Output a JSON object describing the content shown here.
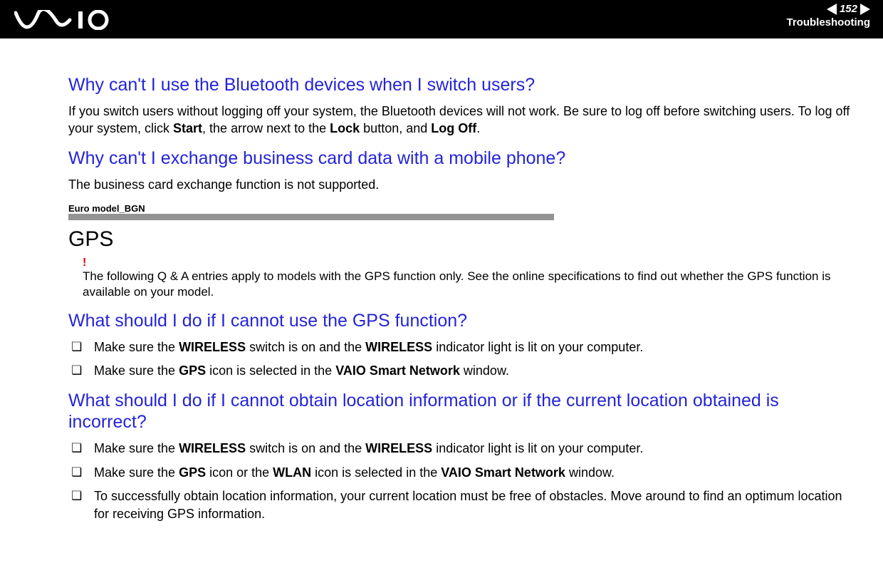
{
  "header": {
    "page_number": "152",
    "section": "Troubleshooting"
  },
  "q1": {
    "title": "Why can't I use the Bluetooth devices when I switch users?",
    "p_pre": "If you switch users without logging off your system, the Bluetooth devices will not work. Be sure to log off before switching users. To log off your system, click ",
    "b1": "Start",
    "mid1": ", the arrow next to the ",
    "b2": "Lock",
    "mid2": " button, and ",
    "b3": "Log Off",
    "post": "."
  },
  "q2": {
    "title": "Why can't I exchange business card data with a mobile phone?",
    "p": "The business card exchange function is not supported."
  },
  "section_tag": "Euro model_BGN",
  "gps": {
    "title": "GPS",
    "bang": "!",
    "note": "The following Q & A entries apply to models with the GPS function only. See the online specifications to find out whether the GPS function is available on your model."
  },
  "q3": {
    "title": "What should I do if I cannot use the GPS function?",
    "items": [
      {
        "pre": "Make sure the ",
        "b1": "WIRELESS",
        "mid1": " switch is on and the ",
        "b2": "WIRELESS",
        "mid2": " indicator light is lit on your computer."
      },
      {
        "pre": "Make sure the ",
        "b1": "GPS",
        "mid1": " icon is selected in the ",
        "b2": "VAIO Smart Network",
        "mid2": " window."
      }
    ]
  },
  "q4": {
    "title": "What should I do if I cannot obtain location information or if the current location obtained is incorrect?",
    "items": [
      {
        "pre": "Make sure the ",
        "b1": "WIRELESS",
        "mid1": " switch is on and the ",
        "b2": "WIRELESS",
        "mid2": " indicator light is lit on your computer."
      },
      {
        "pre": "Make sure the ",
        "b1": "GPS",
        "mid1": " icon or the ",
        "b2": "WLAN",
        "mid2": " icon is selected in the ",
        "b3": "VAIO Smart Network",
        "mid3": " window."
      },
      {
        "pre": "To successfully obtain location information, your current location must be free of obstacles. Move around to find an optimum location for receiving GPS information."
      }
    ]
  }
}
